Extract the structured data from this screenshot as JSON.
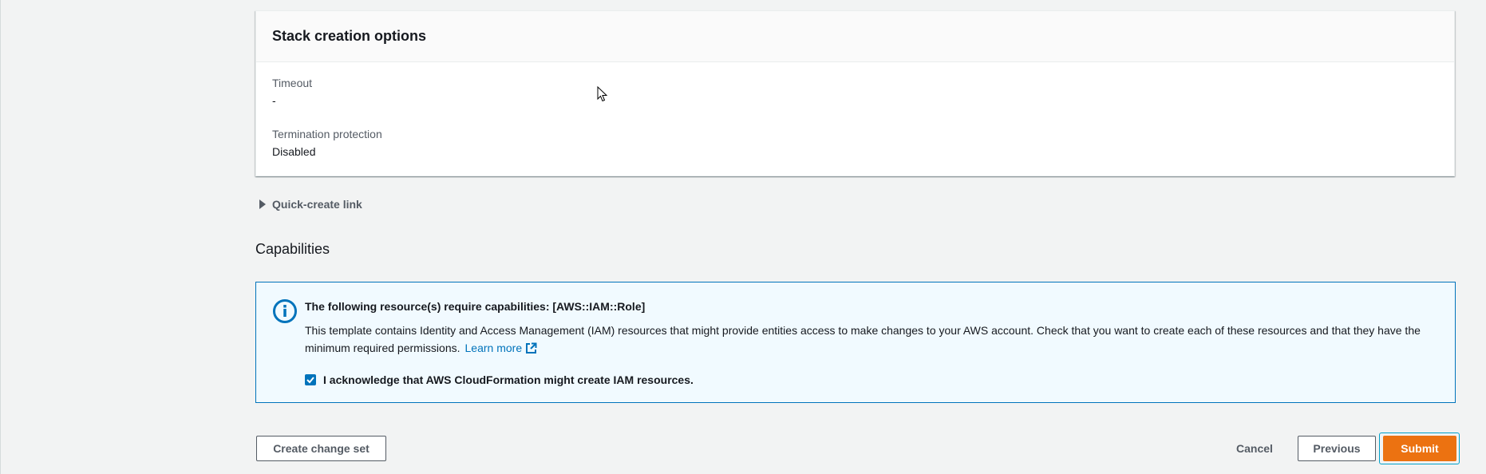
{
  "stack_options": {
    "title": "Stack creation options",
    "timeout_label": "Timeout",
    "timeout_value": "-",
    "termination_label": "Termination protection",
    "termination_value": "Disabled"
  },
  "quick_create": {
    "label": "Quick-create link"
  },
  "capabilities": {
    "heading": "Capabilities",
    "alert_title": "The following resource(s) require capabilities: [AWS::IAM::Role]",
    "alert_body": "This template contains Identity and Access Management (IAM) resources that might provide entities access to make changes to your AWS account. Check that you want to create each of these resources and that they have the minimum required permissions.",
    "learn_more": "Learn more",
    "ack_label": "I acknowledge that AWS CloudFormation might create IAM resources.",
    "ack_checked": true,
    "info_icon": "info-icon"
  },
  "footer": {
    "create_change_set": "Create change set",
    "cancel": "Cancel",
    "previous": "Previous",
    "submit": "Submit"
  },
  "colors": {
    "primary": "#ec7211",
    "link": "#0073bb",
    "info_bg": "#f1faff"
  }
}
